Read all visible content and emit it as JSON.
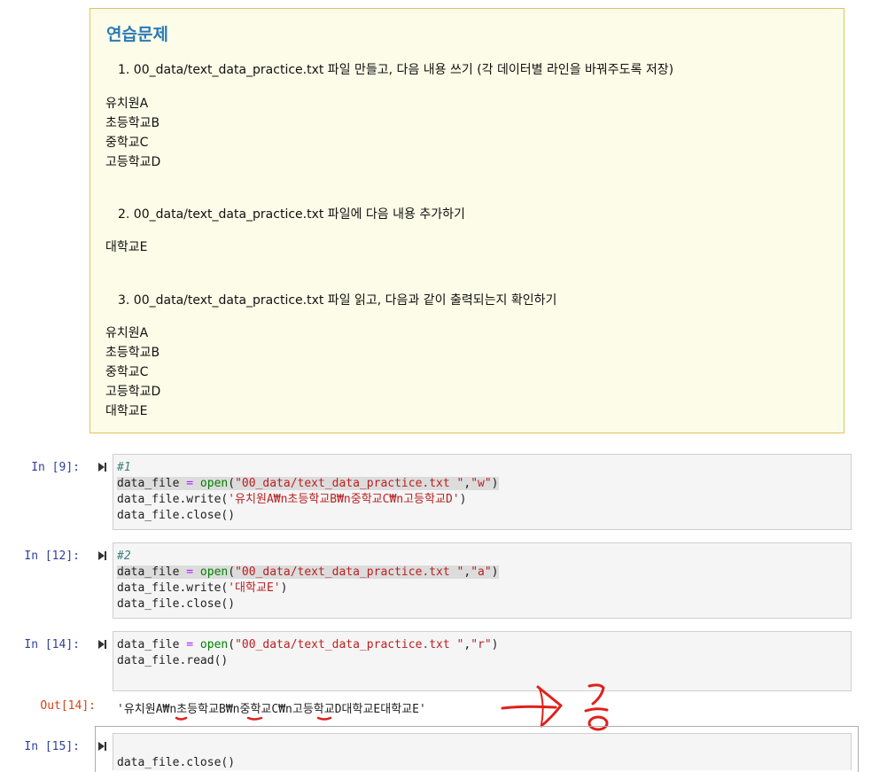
{
  "exercise": {
    "title": "연습문제",
    "q1": "1. 00_data/text_data_practice.txt 파일 만들고, 다음 내용 쓰기 (각 데이터별 라인을 바꿔주도록 저장)",
    "q1_lines": [
      "유치원A",
      "초등학교B",
      "중학교C",
      "고등학교D"
    ],
    "q2": "2. 00_data/text_data_practice.txt 파일에 다음 내용 추가하기",
    "q2_lines": [
      "대학교E"
    ],
    "q3": "3. 00_data/text_data_practice.txt 파일 읽고, 다음과 같이 출력되는지 확인하기",
    "q3_lines": [
      "유치원A",
      "초등학교B",
      "중학교C",
      "고등학교D",
      "대학교E"
    ]
  },
  "cells": {
    "c9": {
      "prompt": "In [9]:",
      "comment": "#1",
      "l2_a": "data_file ",
      "l2_eq": "=",
      "l2_fn": " open",
      "l2_p": "(",
      "l2_s1": "\"00_data/text_data_practice.txt \"",
      "l2_c": ",",
      "l2_s2": "\"w\"",
      "l2_e": ")",
      "l3_a": "data_file.write(",
      "l3_s": "'유치원A₩n초등학교B₩n중학교C₩n고등학교D'",
      "l3_e": ")",
      "l4": "data_file.close()"
    },
    "c12": {
      "prompt": "In [12]:",
      "comment": "#2",
      "l2_a": "data_file ",
      "l2_eq": "=",
      "l2_fn": " open",
      "l2_p": "(",
      "l2_s1": "\"00_data/text_data_practice.txt \"",
      "l2_c": ",",
      "l2_s2": "\"a\"",
      "l2_e": ")",
      "l3_a": "data_file.write(",
      "l3_s": "'대학교E'",
      "l3_e": ")",
      "l4": "data_file.close()"
    },
    "c14": {
      "prompt": "In [14]:",
      "l1_a": "data_file ",
      "l1_eq": "=",
      "l1_fn": " open",
      "l1_p": "(",
      "l1_s1": "\"00_data/text_data_practice.txt \"",
      "l1_c": ",",
      "l1_s2": "\"r\"",
      "l1_e": ")",
      "l2": "data_file.read()",
      "out_prompt": "Out[14]:",
      "output": "'유치원A₩n초등학교B₩n중학교C₩n고등학교D대학교E대학교E'"
    },
    "c15": {
      "prompt": "In [15]:",
      "l1": "data_file.close()"
    }
  },
  "colors": {
    "md_bg": "#fcfce8",
    "md_border": "#e2c25a",
    "title": "#2a7ab9",
    "prompt_in": "#303f9f",
    "prompt_out": "#d84315",
    "string": "#ba2121",
    "builtin": "#008000",
    "annotation": "#e0201a"
  },
  "icons": [
    "run-cell-icon",
    "handwritten-arrow-annotation",
    "handwritten-glyph-annotation",
    "red-underline-mark"
  ]
}
